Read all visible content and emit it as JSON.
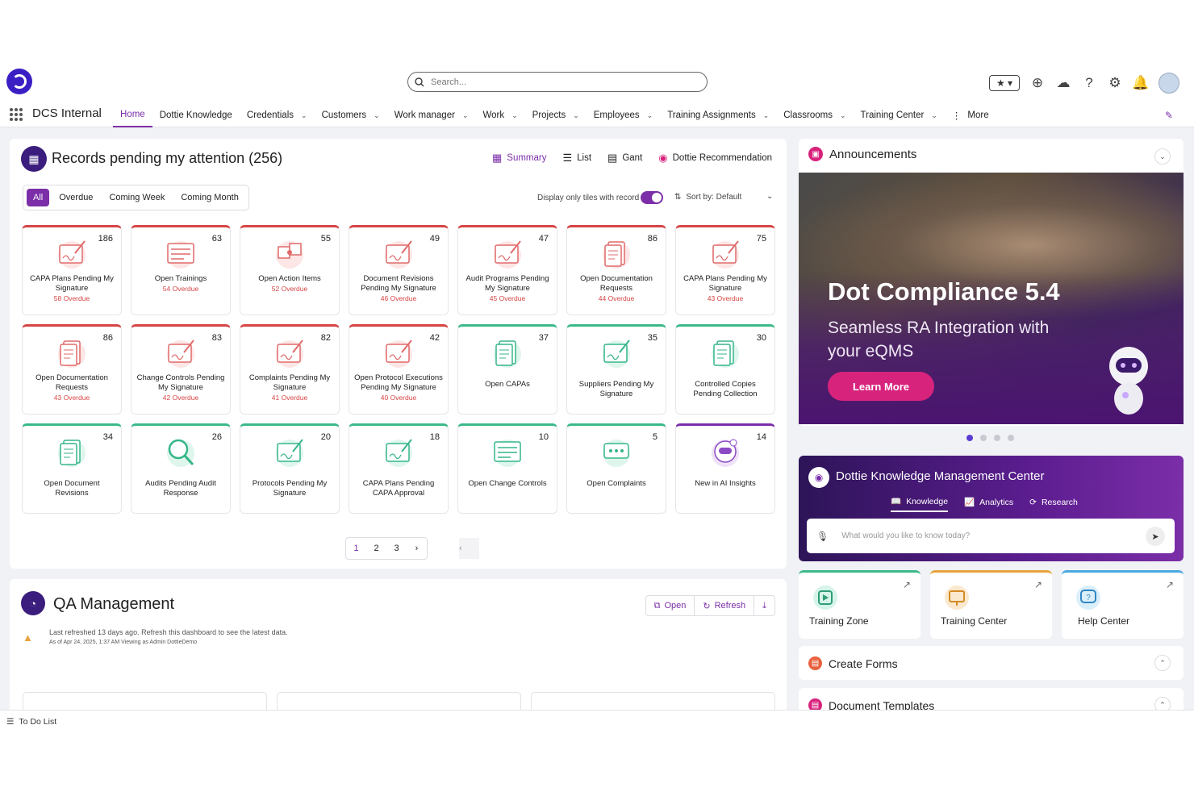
{
  "header": {
    "search_placeholder": "Search...",
    "app_name": "DCS Internal",
    "nav": [
      {
        "label": "Home",
        "active": true,
        "dropdown": false
      },
      {
        "label": "Dottie Knowledge",
        "dropdown": false
      },
      {
        "label": "Credentials",
        "dropdown": true
      },
      {
        "label": "Customers",
        "dropdown": true
      },
      {
        "label": "Work manager",
        "dropdown": true
      },
      {
        "label": "Work",
        "dropdown": true
      },
      {
        "label": "Projects",
        "dropdown": true
      },
      {
        "label": "Employees",
        "dropdown": true
      },
      {
        "label": "Training Assignments",
        "dropdown": true
      },
      {
        "label": "Classrooms",
        "dropdown": true
      },
      {
        "label": "Training Center",
        "dropdown": true
      },
      {
        "label": "More",
        "dropdown": false
      }
    ]
  },
  "records": {
    "title": "Records pending my attention (256)",
    "views": [
      "Summary",
      "List",
      "Gant",
      "Dottie Recommendation"
    ],
    "filters": [
      "All",
      "Overdue",
      "Coming Week",
      "Coming Month"
    ],
    "display_only": "Display only tiles with record",
    "sort": "Sort by: Default",
    "tiles": [
      {
        "count": "186",
        "label": "CAPA Plans Pending My Signature",
        "overdue": "58 Overdue",
        "color": "red",
        "icon": "signature-doc-icon"
      },
      {
        "count": "63",
        "label": "Open Trainings",
        "overdue": "54 Overdue",
        "color": "red",
        "icon": "training-board-icon"
      },
      {
        "count": "55",
        "label": "Open Action Items",
        "overdue": "52 Overdue",
        "color": "red",
        "icon": "puzzle-icon"
      },
      {
        "count": "49",
        "label": "Document Revisions Pending My Signature",
        "overdue": "46 Overdue",
        "color": "red",
        "icon": "signature-doc-icon"
      },
      {
        "count": "47",
        "label": "Audit Programs Pending My Signature",
        "overdue": "45 Overdue",
        "color": "red",
        "icon": "signature-doc-icon"
      },
      {
        "count": "86",
        "label": "Open Documentation Requests",
        "overdue": "44 Overdue",
        "color": "red",
        "icon": "documents-icon"
      },
      {
        "count": "75",
        "label": "CAPA Plans Pending My Signature",
        "overdue": "43 Overdue",
        "color": "red",
        "icon": "signature-doc-icon"
      },
      {
        "count": "86",
        "label": "Open Documentation Requests",
        "overdue": "43 Overdue",
        "color": "red",
        "icon": "documents-icon"
      },
      {
        "count": "83",
        "label": "Change Controls Pending My Signature",
        "overdue": "42 Overdue",
        "color": "red",
        "icon": "signature-doc-icon"
      },
      {
        "count": "82",
        "label": "Complaints Pending My Signature",
        "overdue": "41 Overdue",
        "color": "red",
        "icon": "signature-doc-icon"
      },
      {
        "count": "42",
        "label": "Open Protocol Executions Pending My Signature",
        "overdue": "40 Overdue",
        "color": "red",
        "icon": "signature-doc-icon"
      },
      {
        "count": "37",
        "label": "Open CAPAs",
        "overdue": "",
        "color": "green",
        "icon": "capa-doc-icon"
      },
      {
        "count": "35",
        "label": "Suppliers Pending My Signature",
        "overdue": "",
        "color": "green",
        "icon": "signature-doc-icon"
      },
      {
        "count": "30",
        "label": "Controlled Copies Pending Collection",
        "overdue": "",
        "color": "green",
        "icon": "copies-icon"
      },
      {
        "count": "34",
        "label": "Open Document Revisions",
        "overdue": "",
        "color": "green",
        "icon": "document-icon"
      },
      {
        "count": "26",
        "label": "Audits Pending Audit Response",
        "overdue": "",
        "color": "green",
        "icon": "magnifier-icon"
      },
      {
        "count": "20",
        "label": "Protocols Pending My Signature",
        "overdue": "",
        "color": "green",
        "icon": "signature-doc-icon"
      },
      {
        "count": "18",
        "label": "CAPA Plans Pending CAPA Approval",
        "overdue": "",
        "color": "green",
        "icon": "approval-doc-icon"
      },
      {
        "count": "10",
        "label": "Open Change Controls",
        "overdue": "",
        "color": "green",
        "icon": "forms-icon"
      },
      {
        "count": "5",
        "label": "Open Complaints",
        "overdue": "",
        "color": "green",
        "icon": "complaint-icon"
      },
      {
        "count": "14",
        "label": "New in AI Insights",
        "overdue": "",
        "color": "purple",
        "icon": "ai-insights-icon"
      }
    ],
    "pages": [
      "1",
      "2",
      "3"
    ],
    "current_page": "1"
  },
  "qa": {
    "title": "QA Management",
    "open": "Open",
    "refresh": "Refresh",
    "message": "Last refreshed 13 days ago. Refresh this dashboard to see the latest data.",
    "sub": "As of Apr 24, 2025, 1:37 AM Viewing as Admin DottieDemo"
  },
  "announcements": {
    "title": "Announcements",
    "banner_title": "Dot Compliance 5.4",
    "banner_sub": "Seamless RA Integration with your eQMS",
    "cta": "Learn More",
    "slides": 4,
    "active_slide": 1
  },
  "dottie_km": {
    "title": "Dottie Knowledge Management Center",
    "tabs": [
      "Knowledge",
      "Analytics",
      "Research"
    ],
    "placeholder": "What would you like to know today?"
  },
  "quick_links": [
    {
      "label": "Training Zone"
    },
    {
      "label": "Training Center"
    },
    {
      "label": "Help Center"
    }
  ],
  "create_forms": "Create Forms",
  "document_templates": "Document Templates",
  "todo": "To Do List",
  "colors": {
    "accent": "#7b2ea8",
    "overdue": "#d64545",
    "green": "#3cb98a",
    "pink": "#d8237d"
  }
}
